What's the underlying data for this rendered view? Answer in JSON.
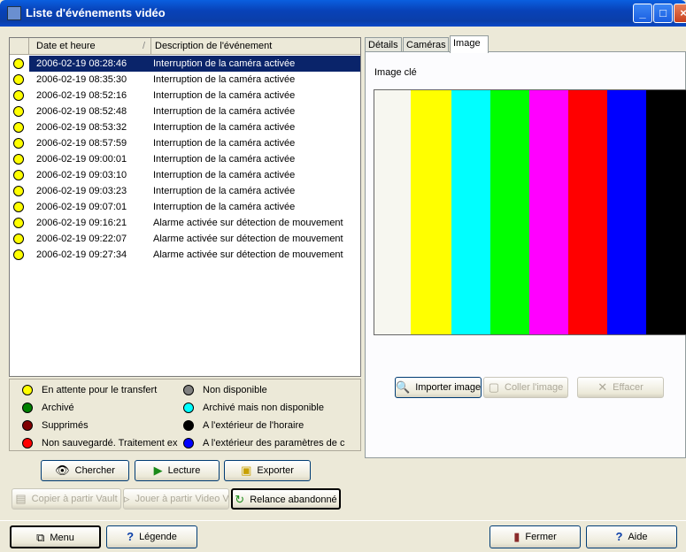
{
  "window": {
    "title": "Liste d'événements vidéo"
  },
  "list": {
    "columns": {
      "date": "Date et heure",
      "description": "Description de l'événement",
      "sort_indicator": "/"
    },
    "rows": [
      {
        "date": "2006-02-19 08:28:46",
        "description": "Interruption de la caméra activée",
        "selected": true
      },
      {
        "date": "2006-02-19 08:35:30",
        "description": "Interruption de la caméra activée"
      },
      {
        "date": "2006-02-19 08:52:16",
        "description": "Interruption de la caméra activée"
      },
      {
        "date": "2006-02-19 08:52:48",
        "description": "Interruption de la caméra activée"
      },
      {
        "date": "2006-02-19 08:53:32",
        "description": "Interruption de la caméra activée"
      },
      {
        "date": "2006-02-19 08:57:59",
        "description": "Interruption de la caméra activée"
      },
      {
        "date": "2006-02-19 09:00:01",
        "description": "Interruption de la caméra activée"
      },
      {
        "date": "2006-02-19 09:03:10",
        "description": "Interruption de la caméra activée"
      },
      {
        "date": "2006-02-19 09:03:23",
        "description": "Interruption de la caméra activée"
      },
      {
        "date": "2006-02-19 09:07:01",
        "description": "Interruption de la caméra activée"
      },
      {
        "date": "2006-02-19 09:16:21",
        "description": "Alarme activée sur détection de mouvement"
      },
      {
        "date": "2006-02-19 09:22:07",
        "description": "Alarme activée sur détection de mouvement"
      },
      {
        "date": "2006-02-19 09:27:34",
        "description": "Alarme activée sur détection de mouvement"
      }
    ],
    "status_color": "#ffff00"
  },
  "legend": [
    {
      "label": "En attente pour le transfert",
      "color": "#ffff00"
    },
    {
      "label": "Non disponible",
      "color": "#808080"
    },
    {
      "label": "Archivé",
      "color": "#008000"
    },
    {
      "label": "Archivé mais non disponible",
      "color": "#00ffff"
    },
    {
      "label": "Supprimés",
      "color": "#800000"
    },
    {
      "label": "A l'extérieur de l'horaire",
      "color": "#000000"
    },
    {
      "label": "Non sauvegardé. Traitement ex",
      "color": "#ff0000"
    },
    {
      "label": "A l'extérieur des paramètres de c",
      "color": "#0000ff"
    }
  ],
  "actions": {
    "search": "Chercher",
    "play": "Lecture",
    "export": "Exporter",
    "copy_vault": "Copier à partir Vault",
    "play_video": "Jouer à partir Video Va",
    "restart": "Relance abandonné"
  },
  "tabs": {
    "details": "Détails",
    "cameras": "Caméras",
    "image": "Image"
  },
  "image_tab": {
    "key_image_label": "Image clé",
    "bars": [
      "#f7f7f0",
      "#ffff00",
      "#00ffff",
      "#00ff00",
      "#ff00ff",
      "#ff0000",
      "#0000ff",
      "#000000"
    ],
    "import": "Importer image",
    "paste": "Coller l'image",
    "clear": "Effacer"
  },
  "bottom": {
    "menu": "Menu",
    "legend": "Légende",
    "close": "Fermer",
    "help": "Aide"
  }
}
